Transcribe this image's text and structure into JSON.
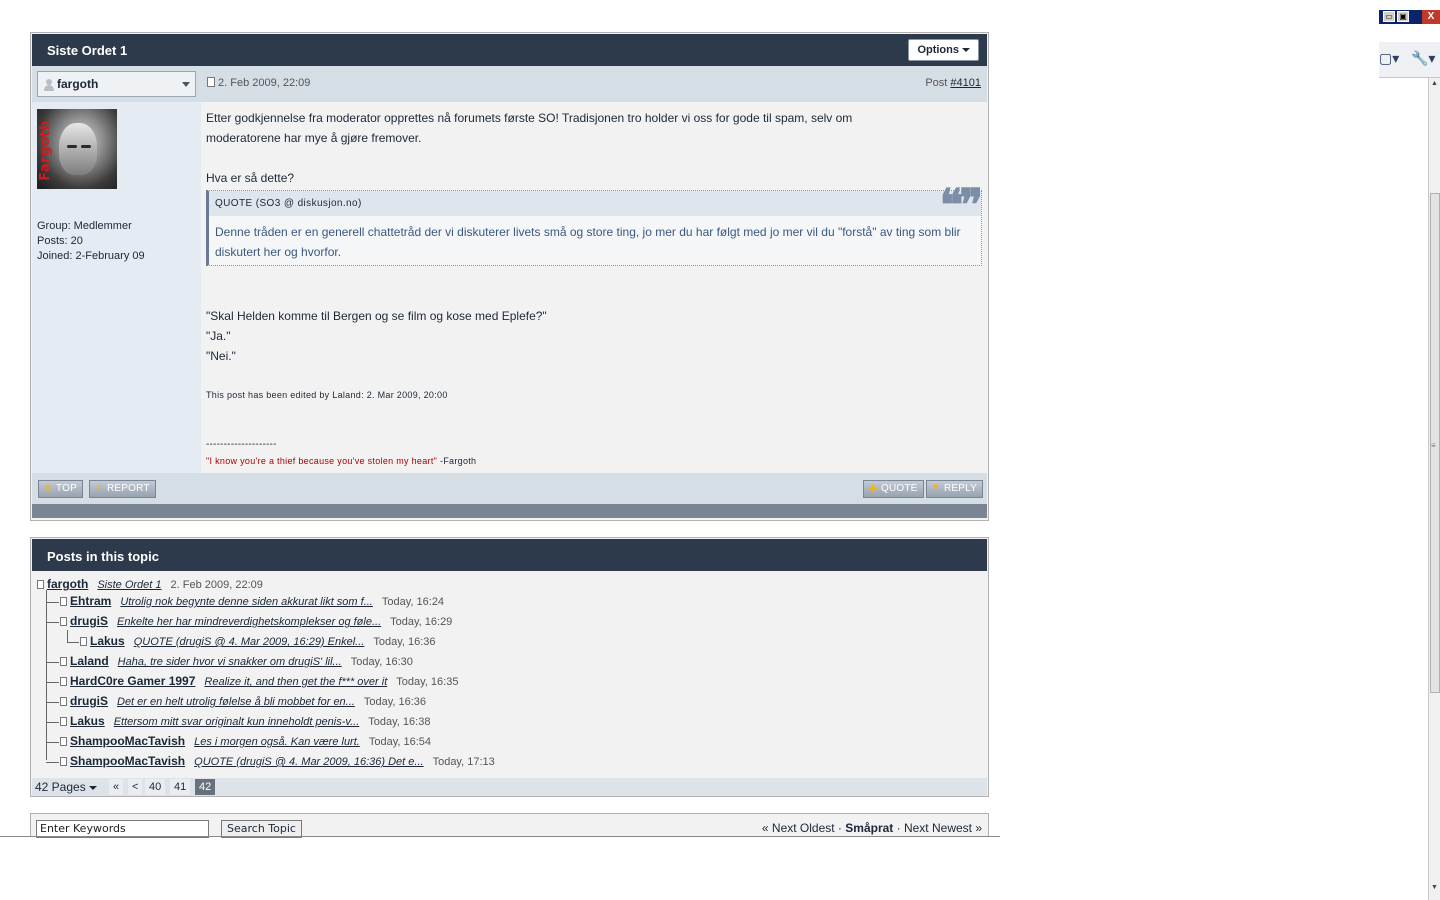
{
  "post": {
    "title": "Siste Ordet 1",
    "options_label": "Options",
    "author": "fargoth",
    "date": "2. Feb 2009, 22:09",
    "post_label": "Post",
    "post_number": "#4101",
    "avatar_text": "Fargoth",
    "author_group": "Group: Medlemmer",
    "author_posts": "Posts: 20",
    "author_joined": "Joined: 2-February 09",
    "body_line1": "Etter godkjennelse fra moderator opprettes nå forumets første SO! Tradisjonen tro holder vi oss for gode til spam, selv om",
    "body_line2": "moderatorene har mye å gjøre fremover.",
    "body_line3": "Hva er så dette?",
    "quote_header": "QUOTE (SO3 @ diskusjon.no)",
    "quote_text": "Denne tråden er en generell chattetråd der vi diskuterer livets små og store ting, jo mer du har følgt med jo mer vil du \"forstå\" av ting som blir diskutert her og hvorfor.",
    "body_line4": "\"Skal Helden komme til Bergen og se film og kose med Eplefe?\"",
    "body_line5": "\"Ja.\"",
    "body_line6": "\"Nei.\"",
    "edit_note": "This post has been edited by Laland: 2. Mar 2009, 20:00",
    "sig_divider": "--------------------",
    "sig_quote": "\"I know you're a thief because you've stolen my heart\"",
    "sig_author": " -Fargoth",
    "buttons": {
      "top": "TOP",
      "report": "REPORT",
      "quote": "QUOTE",
      "reply": "REPLY"
    }
  },
  "topic": {
    "title": "Posts in this topic",
    "rows": [
      {
        "name": "fargoth",
        "snippet": "Siste Ordet 1",
        "time": "2. Feb 2009, 22:09"
      },
      {
        "name": "Ehtram",
        "snippet": "Utrolig nok begynte denne siden akkurat likt som f...",
        "time": "Today, 16:24"
      },
      {
        "name": "drugiS",
        "snippet": "Enkelte her har mindreverdighetskomplekser og føle...",
        "time": "Today, 16:29"
      },
      {
        "name": "Lakus",
        "snippet": "QUOTE (drugiS @ 4. Mar 2009, 16:29) Enkel...",
        "time": "Today, 16:36"
      },
      {
        "name": "Laland",
        "snippet": "Haha, tre sider hvor vi snakker om drugiS' lil...",
        "time": "Today, 16:30"
      },
      {
        "name": "HardC0re Gamer 1997",
        "snippet": "Realize it, and then get the f*** over it",
        "time": "Today, 16:35"
      },
      {
        "name": "drugiS",
        "snippet": "Det er en helt utrolig følelse å bli mobbet for en...",
        "time": "Today, 16:36"
      },
      {
        "name": "Lakus",
        "snippet": "Ettersom mitt svar originalt kun inneholdt penis-v...",
        "time": "Today, 16:38"
      },
      {
        "name": "ShampooMacTavish",
        "snippet": "Les i morgen også. Kan være lurt.",
        "time": "Today, 16:54"
      },
      {
        "name": "ShampooMacTavish",
        "snippet": "QUOTE (drugiS @ 4. Mar 2009, 16:36) Det e...",
        "time": "Today, 17:13"
      }
    ],
    "pager": {
      "pages_label": "42 Pages",
      "first": "«",
      "prev": "<",
      "p40": "40",
      "p41": "41",
      "p42": "42"
    }
  },
  "search": {
    "input_value": "Enter Keywords",
    "button_label": "Search Topic",
    "prev_link": "« Next Oldest",
    "sep1": " · ",
    "forum": "Småprat",
    "sep2": " · ",
    "next_link": "Next Newest »"
  },
  "browser": {
    "close_label": "X",
    "page_icon": "page-menu-icon",
    "tools_icon": "wrench-icon"
  }
}
